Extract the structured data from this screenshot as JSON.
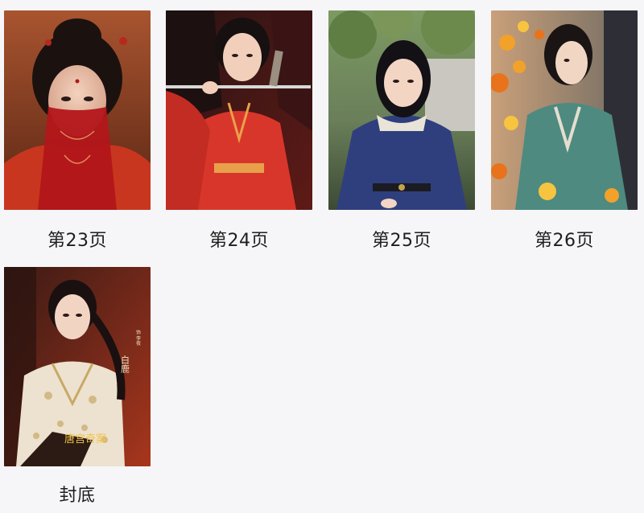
{
  "gallery": {
    "items": [
      {
        "caption": "第23页",
        "image": "woman-red-veil"
      },
      {
        "caption": "第24页",
        "image": "woman-red-dress-sword"
      },
      {
        "caption": "第25页",
        "image": "woman-blue-robe-sitting"
      },
      {
        "caption": "第26页",
        "image": "woman-teal-robe-autumn-leaves"
      },
      {
        "caption": "封底",
        "image": "poster-woman-white-embroidered-robe"
      }
    ],
    "poster_text": {
      "name": "白鹿",
      "role": "饰 李夜",
      "calligraphy": "唐宫奇案"
    }
  },
  "colors": {
    "background": "#f6f6f8",
    "caption_text": "#1e1e1e"
  }
}
